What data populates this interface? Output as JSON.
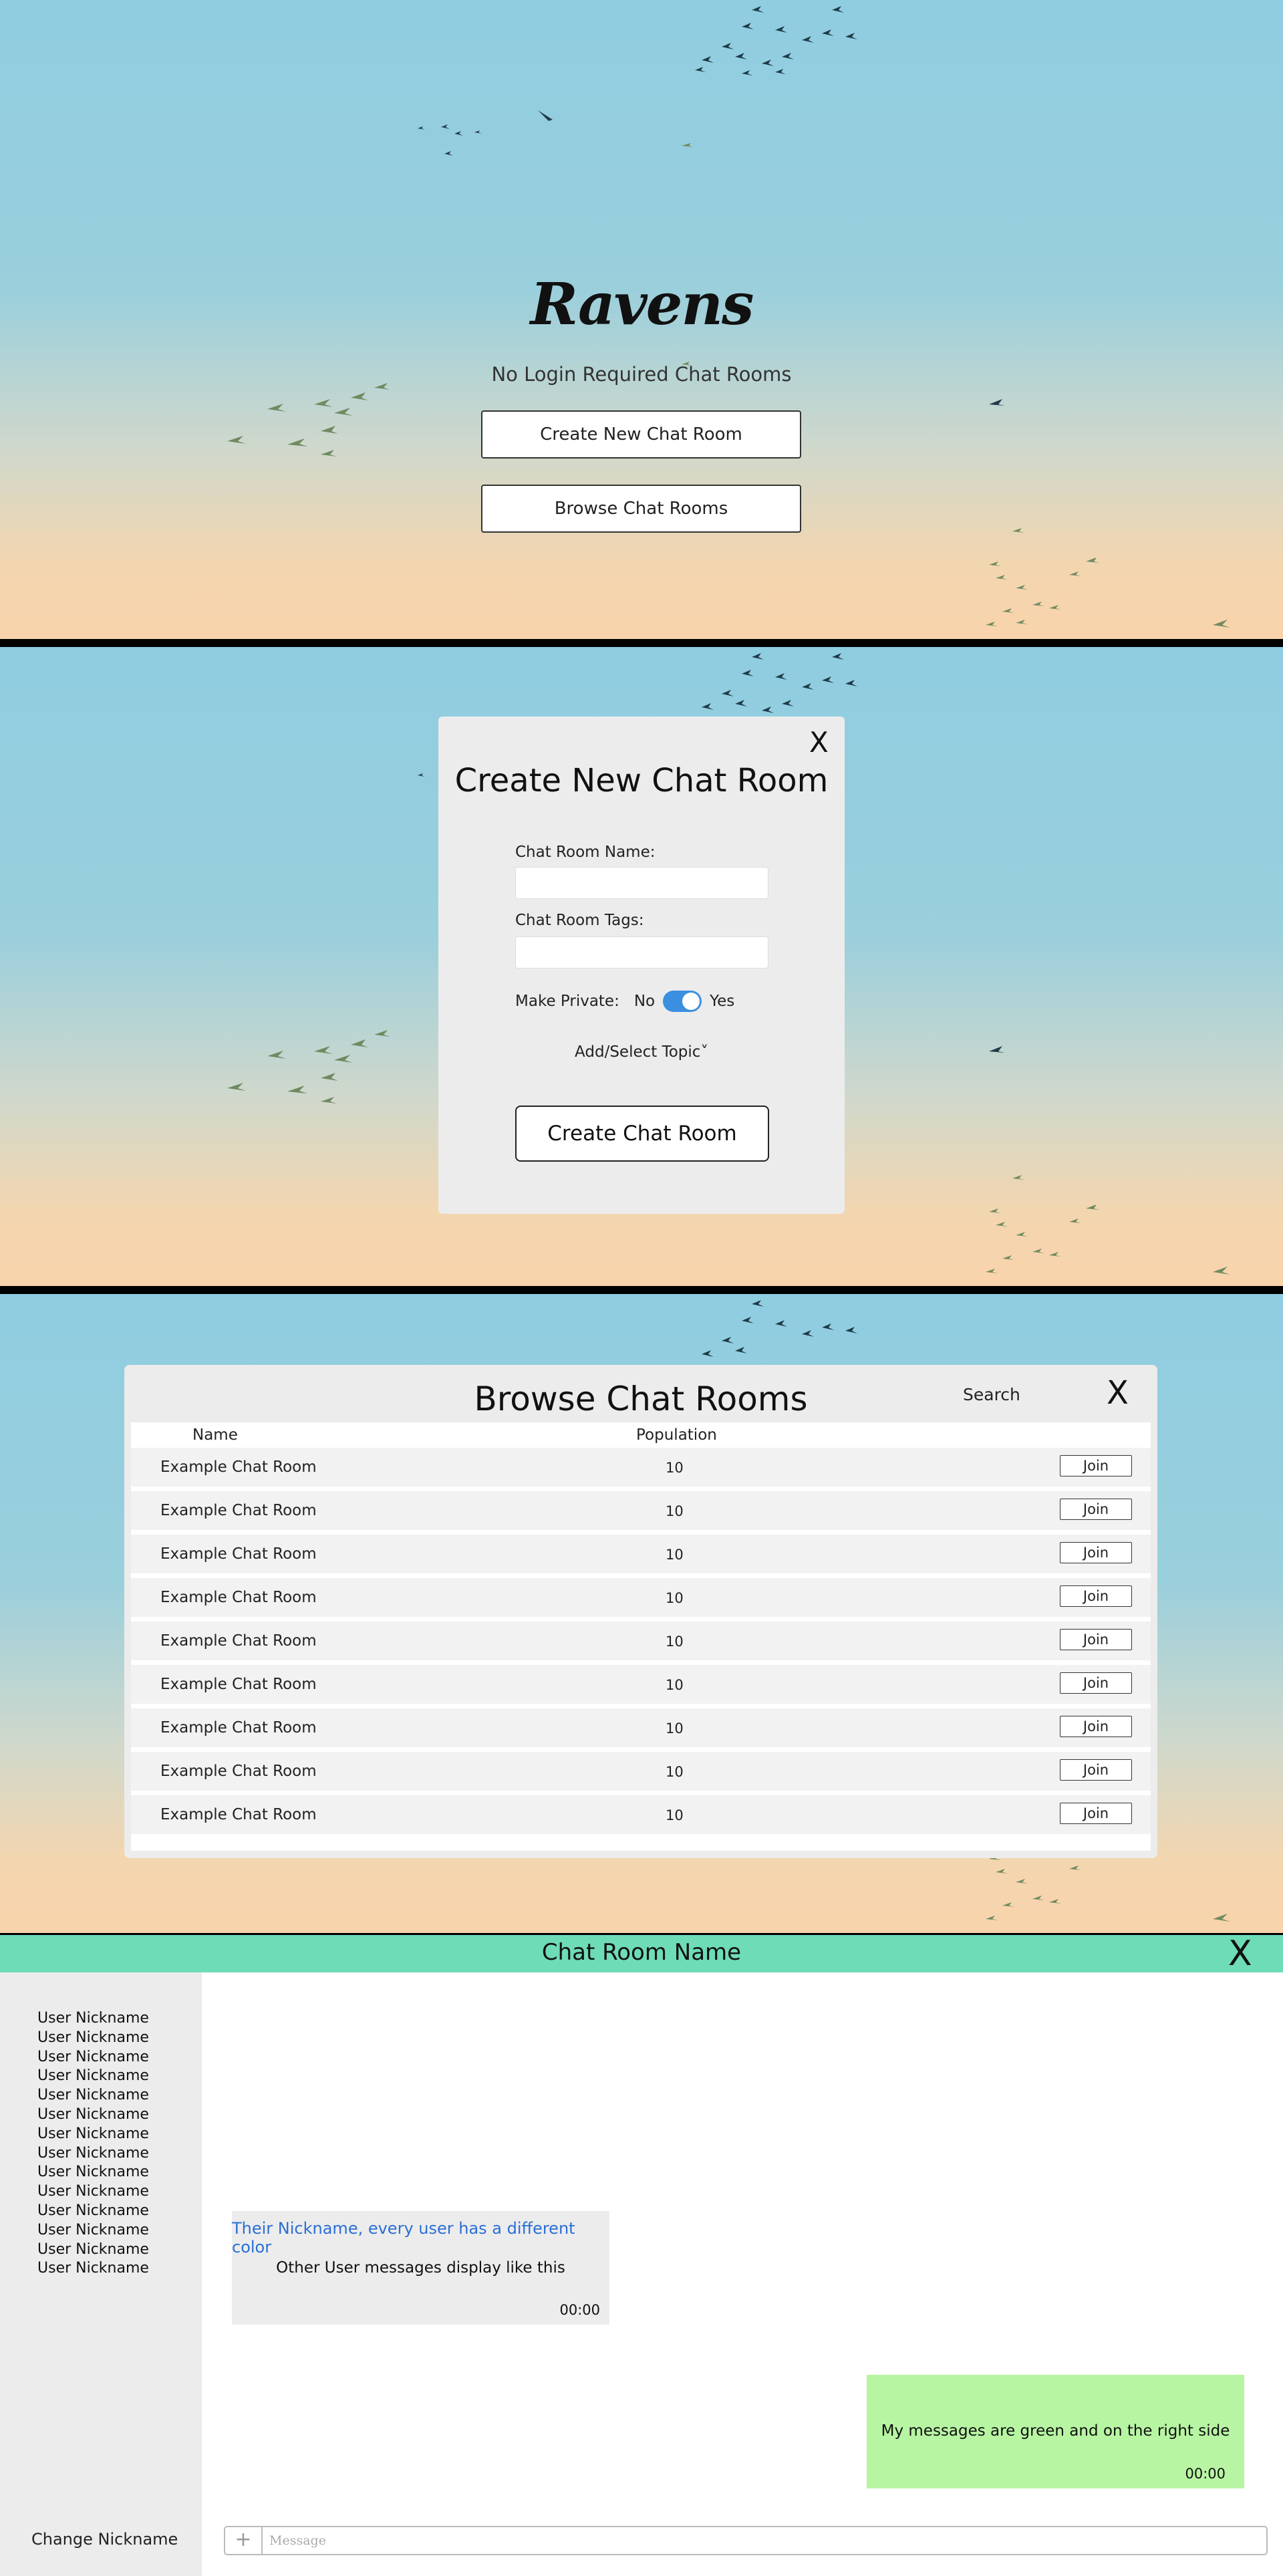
{
  "landing": {
    "logo": "Ravens",
    "tagline": "No Login Required Chat Rooms",
    "create_button": "Create New Chat Room",
    "browse_button": "Browse Chat Rooms"
  },
  "create_modal": {
    "close": "X",
    "title": "Create New Chat Room",
    "name_label": "Chat Room Name:",
    "tags_label": "Chat Room Tags:",
    "private_label": "Make Private:",
    "toggle_no": "No",
    "toggle_yes": "Yes",
    "private_enabled": true,
    "topic": "Add/Select Topic˅",
    "submit": "Create Chat Room"
  },
  "browse_modal": {
    "title": "Browse Chat Rooms",
    "search": "Search",
    "close": "X",
    "col_name": "Name",
    "col_population": "Population",
    "join_label": "Join",
    "rows": [
      {
        "name": "Example Chat Room",
        "population": "10"
      },
      {
        "name": "Example Chat Room",
        "population": "10"
      },
      {
        "name": "Example Chat Room",
        "population": "10"
      },
      {
        "name": "Example Chat Room",
        "population": "10"
      },
      {
        "name": "Example Chat Room",
        "population": "10"
      },
      {
        "name": "Example Chat Room",
        "population": "10"
      },
      {
        "name": "Example Chat Room",
        "population": "10"
      },
      {
        "name": "Example Chat Room",
        "population": "10"
      },
      {
        "name": "Example Chat Room",
        "population": "10"
      }
    ]
  },
  "chat": {
    "title": "Chat Room Name",
    "close": "X",
    "nicknames": [
      "User Nickname",
      "User Nickname",
      "User Nickname",
      "User Nickname",
      "User Nickname",
      "User Nickname",
      "User Nickname",
      "User Nickname",
      "User Nickname",
      "User Nickname",
      "User Nickname",
      "User Nickname",
      "User Nickname",
      "User Nickname"
    ],
    "other_message": {
      "nickname": "Their Nickname, every user has a different color",
      "text": "Other User messages display like this",
      "time": "00:00"
    },
    "my_message": {
      "text": "My messages are green and on the right side",
      "time": "00:00"
    },
    "change_nickname": "Change Nickname",
    "composer_plus": "+",
    "message_placeholder": "Message"
  },
  "colors": {
    "chat_header": "#6edcb7",
    "my_bubble": "#b8f5a3",
    "other_bubble": "#ececec",
    "nickname_color": "#2a6fd6",
    "toggle_on": "#3b8fe0"
  }
}
